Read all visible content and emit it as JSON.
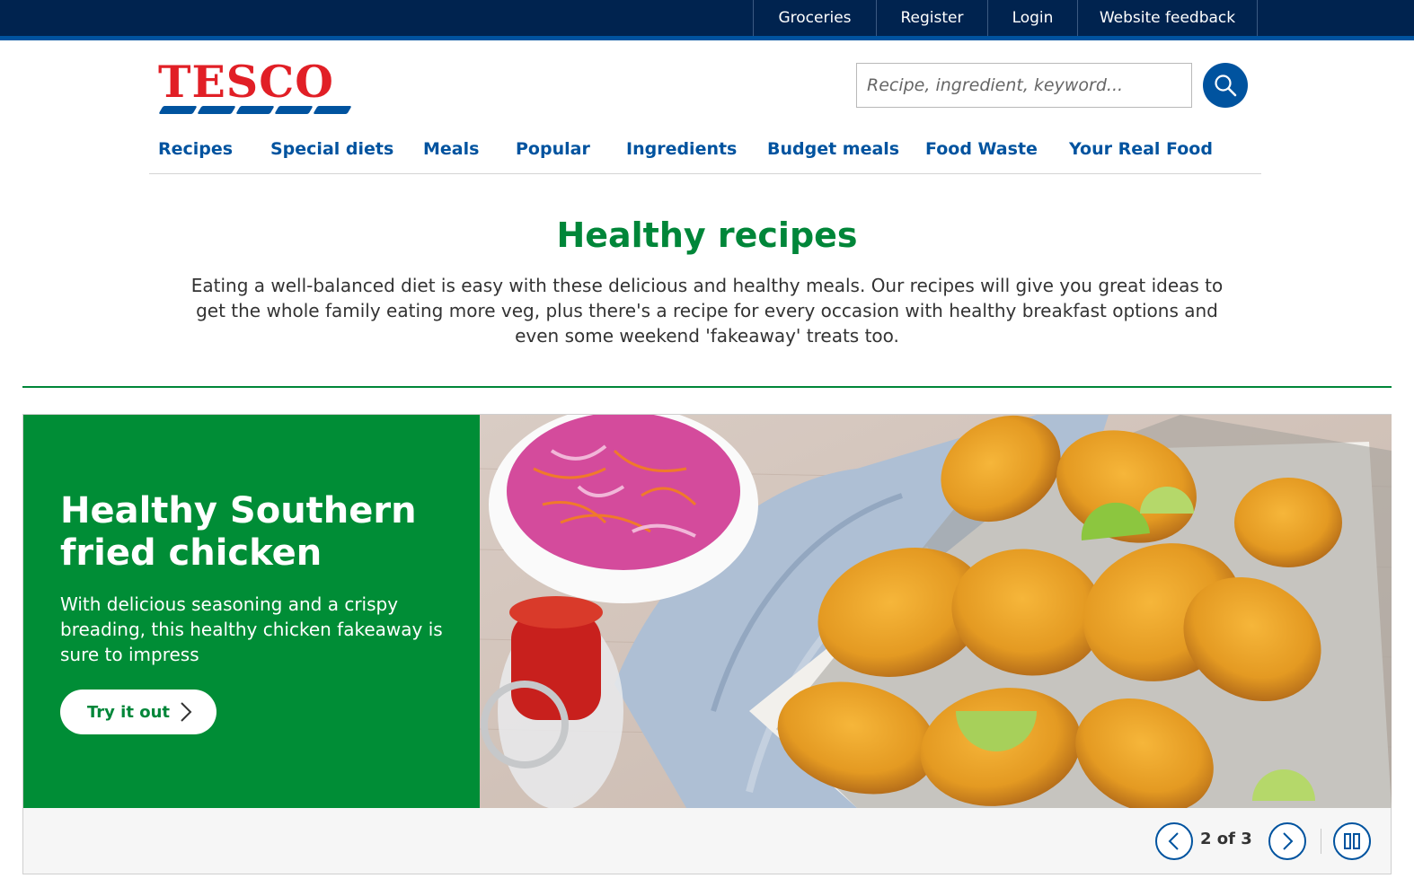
{
  "utility_nav": {
    "items": [
      "Groceries",
      "Register",
      "Login",
      "Website feedback"
    ]
  },
  "brand": {
    "logo_text": "TESCO",
    "colors": {
      "logo_red": "#e11f26",
      "brand_blue": "#00539f",
      "navy": "#00234f",
      "green": "#008639"
    }
  },
  "search": {
    "placeholder": "Recipe, ingredient, keyword...",
    "value": "",
    "button_icon": "search-icon"
  },
  "main_nav": {
    "items": [
      "Recipes",
      "Special diets",
      "Meals",
      "Popular",
      "Ingredients",
      "Budget meals",
      "Food Waste",
      "Your Real Food"
    ]
  },
  "page": {
    "title": "Healthy recipes",
    "intro": "Eating a well-balanced diet is easy with these delicious and healthy meals. Our recipes will give you great ideas to get the whole family eating more veg, plus there's a recipe for every occasion with healthy breakfast options and even some weekend 'fakeaway' treats too."
  },
  "carousel": {
    "slide": {
      "title": "Healthy Southern fried chicken",
      "description": "With delicious seasoning and a crispy breading, this healthy chicken fakeaway is sure to impress",
      "cta_label": "Try it out",
      "cta_icon": "chevron-right-icon",
      "image": "fried-chicken-photo"
    },
    "counter": "2 of 3",
    "prev_icon": "chevron-left-icon",
    "next_icon": "chevron-right-icon",
    "pause_icon": "pause-icon"
  }
}
